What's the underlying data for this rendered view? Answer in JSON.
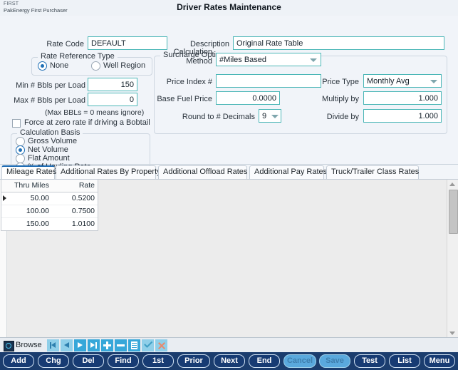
{
  "window": {
    "brand_line1": "FIRST",
    "brand_line2": "PakEnergy First Purchaser",
    "title": "Driver Rates Maintenance"
  },
  "form": {
    "rate_code_label": "Rate Code",
    "rate_code_value": "DEFAULT",
    "description_label": "Description",
    "description_value": "Original Rate Table",
    "rate_reference_type": {
      "caption": "Rate Reference Type",
      "options": [
        "None",
        "Well Region"
      ],
      "selected": "None"
    },
    "min_bbls_label": "Min # Bbls per Load",
    "min_bbls_value": "150",
    "max_bbls_label": "Max # Bbls per Load",
    "max_bbls_value": "0",
    "max_bbls_note": "(Max BBLs = 0 means ignore)",
    "bobtail_label": "Force at zero rate if driving a Bobtail",
    "bobtail_checked": false,
    "calculation_basis": {
      "caption": "Calculation Basis",
      "options": [
        "Gross Volume",
        "Net Volume",
        "Flat Amount",
        "% of Hauling Rate"
      ],
      "selected": "Net Volume"
    },
    "surcharge": {
      "caption": "Surcharge Options",
      "calc_method_label_1": "Calculation",
      "calc_method_label_2": "Method",
      "calc_method_value": "#Miles Based",
      "price_index_label": "Price Index #",
      "price_index_value": "",
      "base_fuel_label": "Base Fuel Price",
      "base_fuel_value": "0.0000",
      "round_label": "Round to # Decimals",
      "round_value": "9",
      "price_type_label": "Price Type",
      "price_type_value": "Monthly Avg",
      "multiply_label": "Multiply by",
      "multiply_value": "1.000",
      "divide_label": "Divide by",
      "divide_value": "1.000"
    }
  },
  "tabs": [
    {
      "label": "Mileage Rates",
      "active": true
    },
    {
      "label": "Additional Rates By Property",
      "active": false
    },
    {
      "label": "Additional Offload Rates",
      "active": false
    },
    {
      "label": "Additional Pay Rates",
      "active": false
    },
    {
      "label": "Truck/Trailer Class Rates",
      "active": false
    }
  ],
  "grid": {
    "columns": [
      "Thru Miles",
      "Rate"
    ],
    "rows": [
      {
        "thru_miles": "50.00",
        "rate": "0.5200",
        "current": true
      },
      {
        "thru_miles": "100.00",
        "rate": "0.7500",
        "current": false
      },
      {
        "thru_miles": "150.00",
        "rate": "1.0100",
        "current": false
      }
    ]
  },
  "browse_bar": {
    "label": "Browse",
    "nav": [
      {
        "name": "first-record-icon",
        "state": "disabled"
      },
      {
        "name": "prior-record-icon",
        "state": "disabled"
      },
      {
        "name": "next-record-icon",
        "state": "enabled"
      },
      {
        "name": "last-record-icon",
        "state": "enabled"
      },
      {
        "name": "add-record-icon",
        "state": "enabled"
      },
      {
        "name": "delete-record-icon",
        "state": "enabled"
      },
      {
        "name": "edit-record-icon",
        "state": "enabled"
      },
      {
        "name": "post-edit-icon",
        "state": "disabled"
      },
      {
        "name": "cancel-edit-icon",
        "state": "disabled"
      }
    ]
  },
  "buttons": [
    {
      "label": "Add",
      "accel": "A",
      "disabled": false
    },
    {
      "label": "Chg",
      "accel": "C",
      "disabled": false
    },
    {
      "label": "Del",
      "accel": "D",
      "disabled": false
    },
    {
      "label": "Find",
      "accel": "F",
      "disabled": false
    },
    {
      "label": "1st",
      "accel": "1",
      "disabled": false
    },
    {
      "label": "Prior",
      "accel": "P",
      "disabled": false
    },
    {
      "label": "Next",
      "accel": "N",
      "disabled": false
    },
    {
      "label": "End",
      "accel": "E",
      "disabled": false
    },
    {
      "label": "Cancel",
      "accel": "",
      "disabled": true
    },
    {
      "label": "Save",
      "accel": "",
      "disabled": true
    },
    {
      "label": "Test",
      "accel": "T",
      "disabled": false
    },
    {
      "label": "List",
      "accel": "L",
      "disabled": false
    },
    {
      "label": "Menu",
      "accel": "M",
      "disabled": false
    }
  ],
  "colors": {
    "field_border": "#4cb7b7",
    "button_bar": "#1b3d6e",
    "accent_tab": "#1666b0"
  }
}
